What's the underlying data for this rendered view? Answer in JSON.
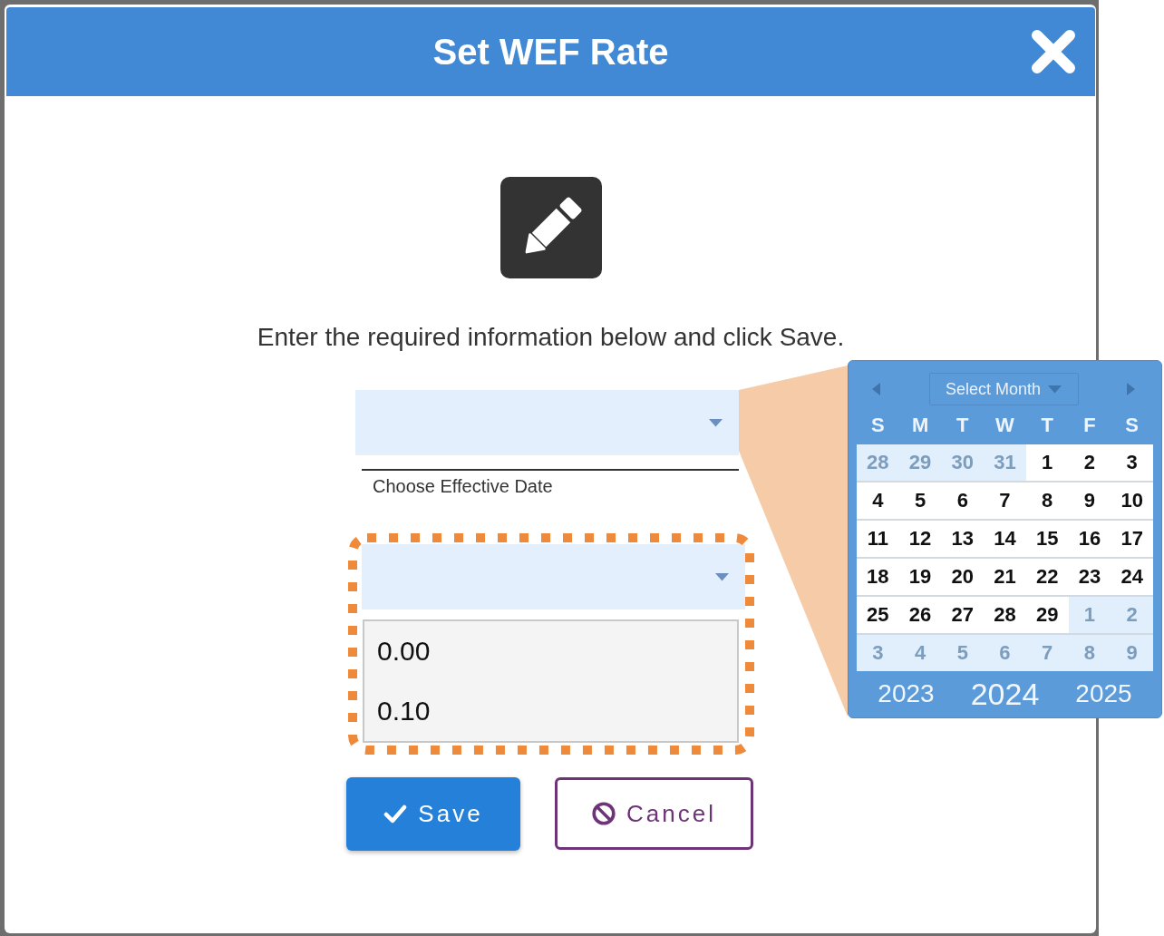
{
  "dialog": {
    "title": "Set WEF Rate",
    "instruction": "Enter the required information below and click Save."
  },
  "date_field": {
    "label": "Choose Effective Date",
    "expanded": true,
    "calendar": {
      "month_select": "Select Month",
      "weekdays": [
        "S",
        "M",
        "T",
        "W",
        "T",
        "F",
        "S"
      ],
      "weeks": [
        [
          {
            "day": "28",
            "current_month": false
          },
          {
            "day": "29",
            "current_month": false
          },
          {
            "day": "30",
            "current_month": false
          },
          {
            "day": "31",
            "current_month": false
          },
          {
            "day": "1",
            "current_month": true
          },
          {
            "day": "2",
            "current_month": true
          },
          {
            "day": "3",
            "current_month": true
          }
        ],
        [
          {
            "day": "4",
            "current_month": true
          },
          {
            "day": "5",
            "current_month": true
          },
          {
            "day": "6",
            "current_month": true
          },
          {
            "day": "7",
            "current_month": true
          },
          {
            "day": "8",
            "current_month": true
          },
          {
            "day": "9",
            "current_month": true
          },
          {
            "day": "10",
            "current_month": true
          }
        ],
        [
          {
            "day": "11",
            "current_month": true
          },
          {
            "day": "12",
            "current_month": true
          },
          {
            "day": "13",
            "current_month": true
          },
          {
            "day": "14",
            "current_month": true
          },
          {
            "day": "15",
            "current_month": true
          },
          {
            "day": "16",
            "current_month": true
          },
          {
            "day": "17",
            "current_month": true
          }
        ],
        [
          {
            "day": "18",
            "current_month": true
          },
          {
            "day": "19",
            "current_month": true
          },
          {
            "day": "20",
            "current_month": true
          },
          {
            "day": "21",
            "current_month": true
          },
          {
            "day": "22",
            "current_month": true
          },
          {
            "day": "23",
            "current_month": true
          },
          {
            "day": "24",
            "current_month": true
          }
        ],
        [
          {
            "day": "25",
            "current_month": true
          },
          {
            "day": "26",
            "current_month": true
          },
          {
            "day": "27",
            "current_month": true
          },
          {
            "day": "28",
            "current_month": true
          },
          {
            "day": "29",
            "current_month": true
          },
          {
            "day": "1",
            "current_month": false
          },
          {
            "day": "2",
            "current_month": false
          }
        ],
        [
          {
            "day": "3",
            "current_month": false
          },
          {
            "day": "4",
            "current_month": false
          },
          {
            "day": "5",
            "current_month": false
          },
          {
            "day": "6",
            "current_month": false
          },
          {
            "day": "7",
            "current_month": false
          },
          {
            "day": "8",
            "current_month": false
          },
          {
            "day": "9",
            "current_month": false
          }
        ]
      ],
      "years": [
        {
          "label": "2023",
          "selected": false
        },
        {
          "label": "2024",
          "selected": true
        },
        {
          "label": "2025",
          "selected": false
        }
      ]
    }
  },
  "rate_field": {
    "highlighted": true,
    "expanded": true,
    "options": [
      "0.00",
      "0.10"
    ]
  },
  "buttons": [
    {
      "label": "Save",
      "kind": "save"
    },
    {
      "label": "Cancel",
      "kind": "cancel"
    }
  ]
}
